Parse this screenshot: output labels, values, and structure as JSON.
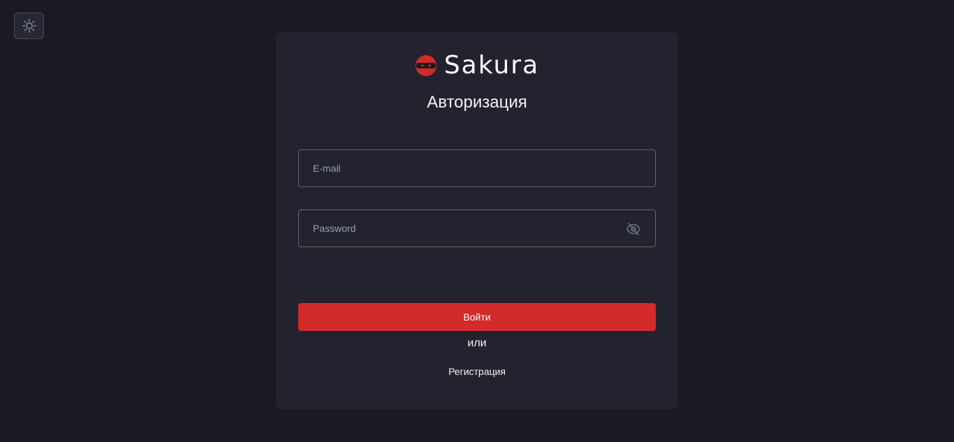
{
  "brand": {
    "name": "Sakura",
    "accent_color": "#d32a2a"
  },
  "theme_toggle": {
    "icon": "sun-icon"
  },
  "auth": {
    "title": "Авторизация",
    "email_placeholder": "E-mail",
    "password_placeholder": "Password",
    "password_toggle_icon": "eye-off-icon",
    "login_label": "Войти",
    "or_label": "или",
    "register_label": "Регистрация"
  }
}
